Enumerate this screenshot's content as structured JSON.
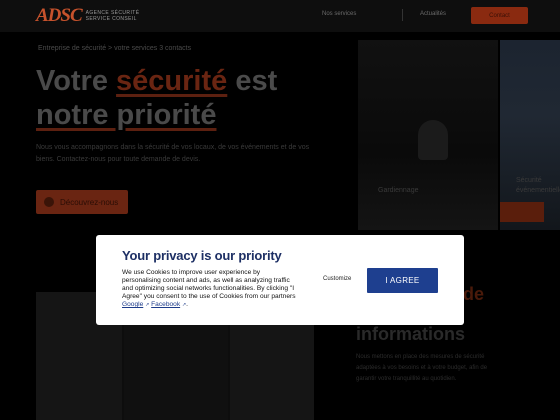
{
  "header": {
    "logo_mark": "ADSC",
    "logo_line1": "AGENCE SÉCURITÉ",
    "logo_line2": "SERVICE CONSEIL",
    "nav_link_1": "Nos services",
    "nav_link_2": "Actualités",
    "contact_label": "Contact"
  },
  "hero": {
    "breadcrumb": "Entreprise de sécurité > votre services 3 contacts",
    "title_part1": "Votre ",
    "title_highlight": "sécurité",
    "title_part2": " est",
    "title_line2": "notre priorité",
    "description": "Nous vous accompagnons dans la sécurité de vos locaux, de vos événements et de vos biens. Contactez-nous pour toute demande de devis.",
    "discover_label": "Découvrez-nous"
  },
  "side": {
    "caption_1": "Gardiennage",
    "caption_2": "Sécurité événementielle",
    "section_title_line1": "Nos valeurs de",
    "section_title_line2": "informations",
    "section_desc": "Nous mettons en place des mesures de sécurité adaptées à vos besoins et à votre budget, afin de garantir votre tranquillité au quotidien."
  },
  "consent": {
    "title": "Your privacy is our priority",
    "text_1": "We use Cookies to improve user experience by personalising content and ads, as well as analyzing traffic and optimizing social networks functionalities. By clicking \"I Agree\" you consent to the use of Cookies from our partners ",
    "link_google": "Google",
    "link_facebook": "Facebook",
    "customize_label": "Customize",
    "agree_label": "I AGREE"
  },
  "colors": {
    "brand_orange": "#c6522c",
    "agree_blue": "#1e3f8f",
    "title_navy": "#1d2f64"
  },
  "icons": {
    "external_link": "external-link-icon",
    "discover_arrow": "arrow-icon"
  }
}
